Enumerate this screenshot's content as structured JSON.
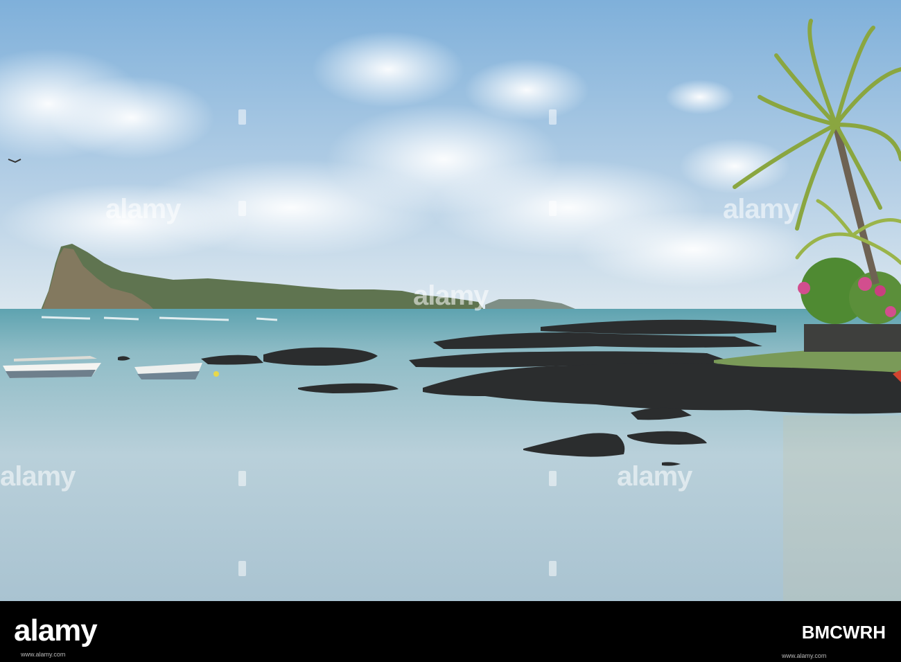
{
  "watermark": {
    "text": "alamy"
  },
  "footer": {
    "logo": "alamy",
    "image_id": "BMCWRH",
    "site": "www.alamy.com"
  },
  "colors": {
    "sky_top": "#8cb8dc",
    "sky_horizon": "#d6e4ee",
    "sea": "#b6cdd8",
    "rock": "#2b2d2e",
    "island": "#5b6e4a",
    "footer_bg": "#000000"
  }
}
